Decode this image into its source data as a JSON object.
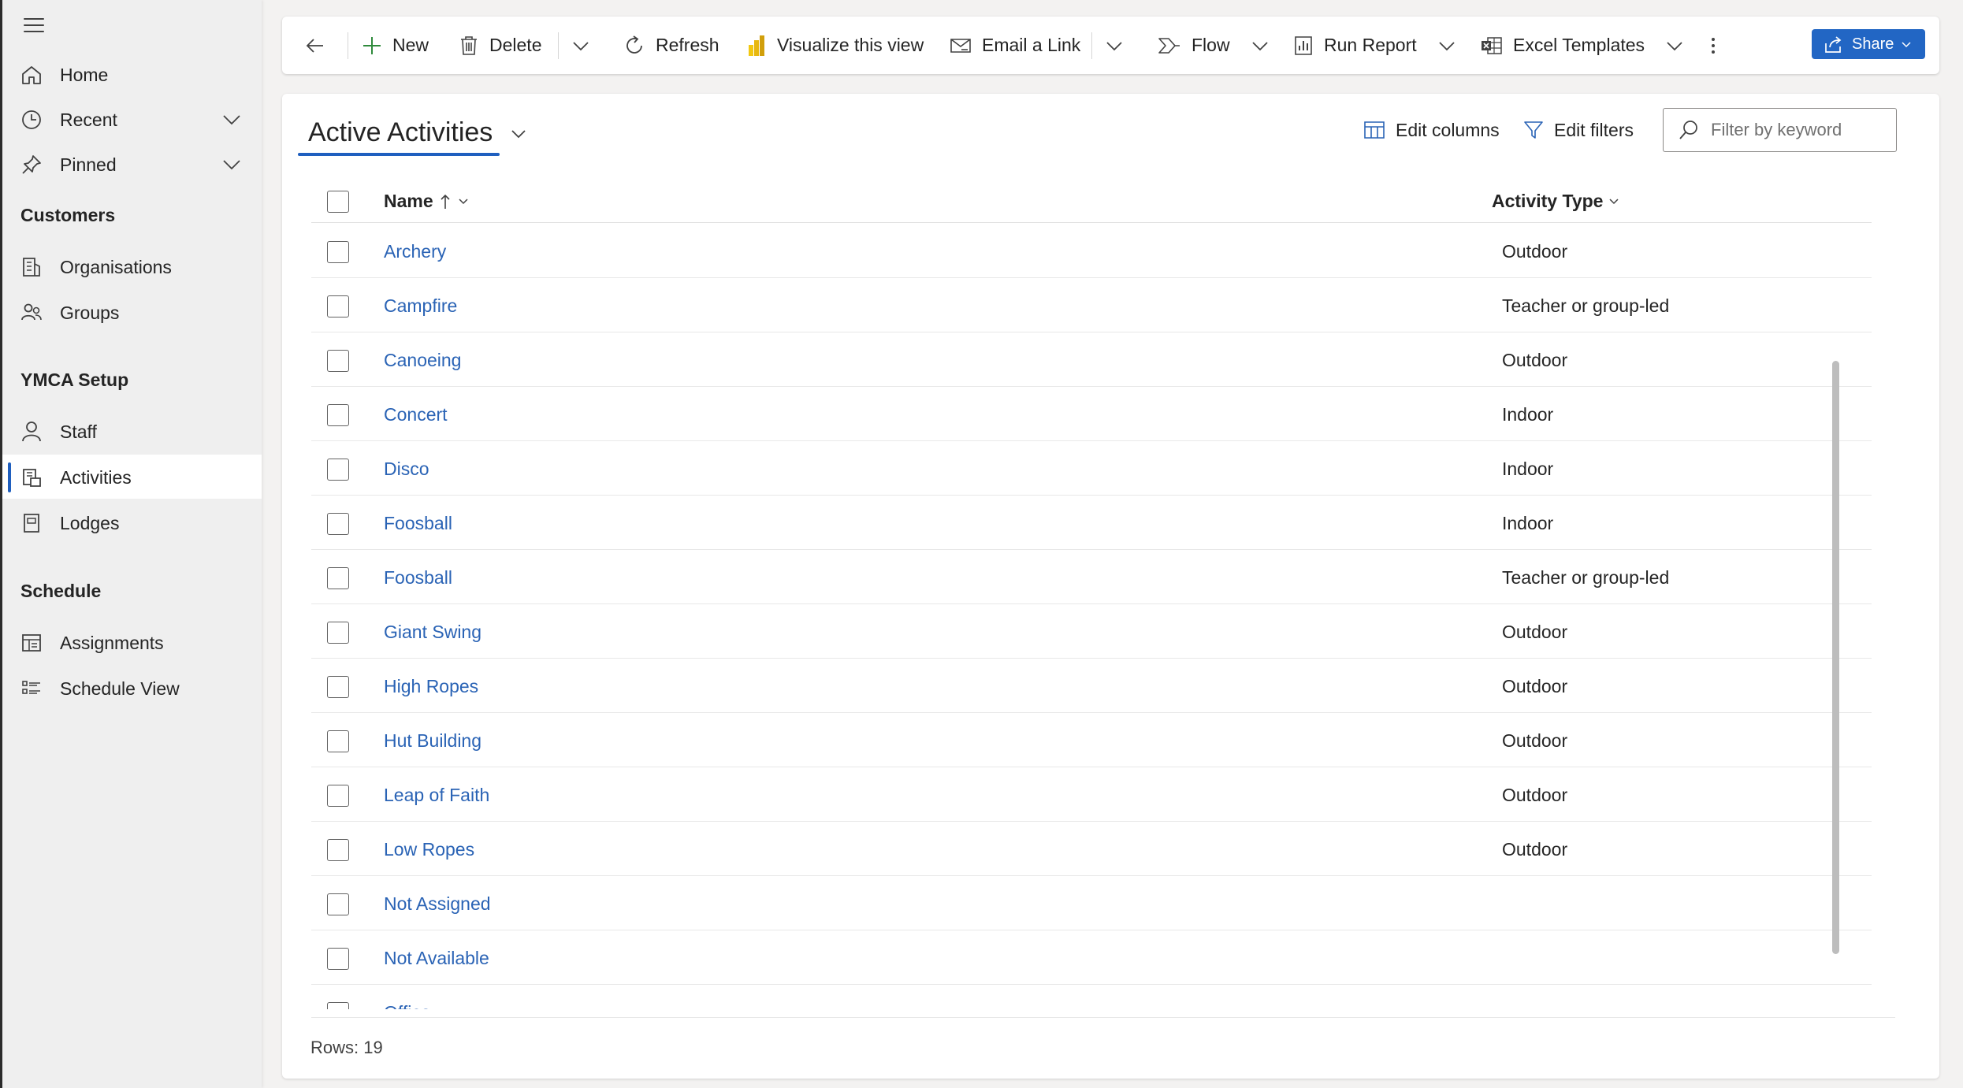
{
  "sidebar": {
    "menu_icon": "hamburger-icon",
    "top_items": [
      {
        "label": "Home",
        "icon": "home-icon"
      },
      {
        "label": "Recent",
        "icon": "clock-icon"
      },
      {
        "label": "Pinned",
        "icon": "pin-icon"
      }
    ],
    "sections": [
      {
        "title": "Customers",
        "items": [
          {
            "label": "Organisations",
            "icon": "organisation-icon"
          },
          {
            "label": "Groups",
            "icon": "groups-icon"
          }
        ]
      },
      {
        "title": "YMCA Setup",
        "items": [
          {
            "label": "Staff",
            "icon": "person-icon"
          },
          {
            "label": "Activities",
            "icon": "activities-icon",
            "selected": true
          },
          {
            "label": "Lodges",
            "icon": "lodge-icon"
          }
        ]
      },
      {
        "title": "Schedule",
        "items": [
          {
            "label": "Assignments",
            "icon": "assignments-icon"
          },
          {
            "label": "Schedule View",
            "icon": "schedule-list-icon"
          }
        ]
      }
    ]
  },
  "command_bar": {
    "new_label": "New",
    "delete_label": "Delete",
    "refresh_label": "Refresh",
    "visualize_label": "Visualize this view",
    "email_label": "Email a Link",
    "flow_label": "Flow",
    "run_report_label": "Run Report",
    "excel_templates_label": "Excel Templates",
    "share_label": "Share"
  },
  "view": {
    "title": "Active Activities",
    "edit_columns_label": "Edit columns",
    "edit_filters_label": "Edit filters",
    "search_placeholder": "Filter by keyword"
  },
  "grid": {
    "columns": {
      "name": "Name",
      "activity_type": "Activity Type"
    },
    "rows": [
      {
        "name": "Archery",
        "type": "Outdoor"
      },
      {
        "name": "Campfire",
        "type": "Teacher or group-led"
      },
      {
        "name": "Canoeing",
        "type": "Outdoor"
      },
      {
        "name": "Concert",
        "type": "Indoor"
      },
      {
        "name": "Disco",
        "type": "Indoor"
      },
      {
        "name": "Foosball",
        "type": "Indoor"
      },
      {
        "name": "Foosball",
        "type": "Teacher or group-led"
      },
      {
        "name": "Giant Swing",
        "type": "Outdoor"
      },
      {
        "name": "High Ropes",
        "type": "Outdoor"
      },
      {
        "name": "Hut Building",
        "type": "Outdoor"
      },
      {
        "name": "Leap of Faith",
        "type": "Outdoor"
      },
      {
        "name": "Low Ropes",
        "type": "Outdoor"
      },
      {
        "name": "Not Assigned",
        "type": ""
      },
      {
        "name": "Not Available",
        "type": ""
      },
      {
        "name": "Office",
        "type": ""
      }
    ],
    "rows_count": "Rows: 19"
  },
  "colors": {
    "accent": "#1f5fbf",
    "link": "#2a63b5",
    "share_button": "#2266c4"
  }
}
